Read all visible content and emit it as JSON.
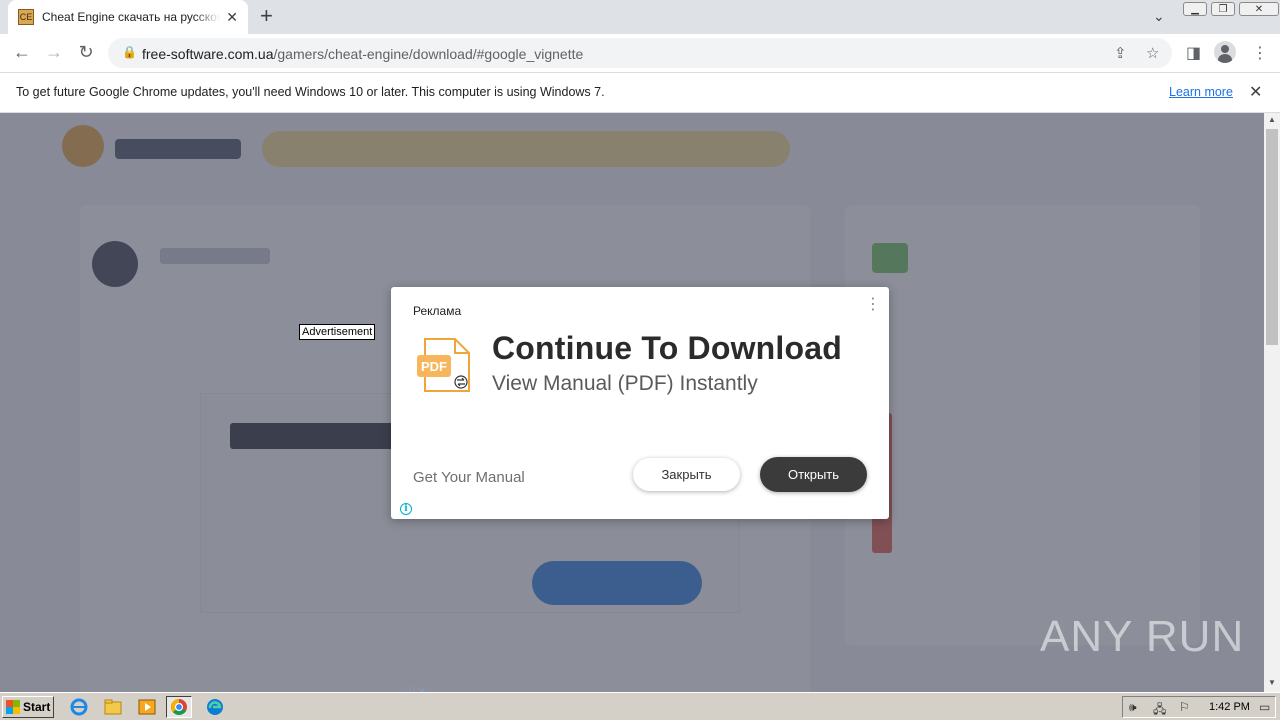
{
  "browser": {
    "tab": {
      "title": "Cheat Engine скачать на русском языке"
    },
    "url": {
      "domain": "free-software.com.ua",
      "path": "/gamers/cheat-engine/download/#google_vignette"
    }
  },
  "infobar": {
    "message": "To get future Google Chrome updates, you'll need Windows 10 or later. This computer is using Windows 7.",
    "link_label": "Learn more"
  },
  "page": {
    "advertisement_label": "Advertisement"
  },
  "ad": {
    "label": "Реклама",
    "headline": "Continue To Download",
    "subheadline": "View Manual (PDF) Instantly",
    "cta_text": "Get Your Manual",
    "close_label": "Закрыть",
    "open_label": "Открыть",
    "icon": "pdf-file-icon",
    "icon_text": "PDF"
  },
  "watermark": {
    "text": "ANY RUN"
  },
  "taskbar": {
    "start_label": "Start",
    "clock": "1:42 PM"
  }
}
